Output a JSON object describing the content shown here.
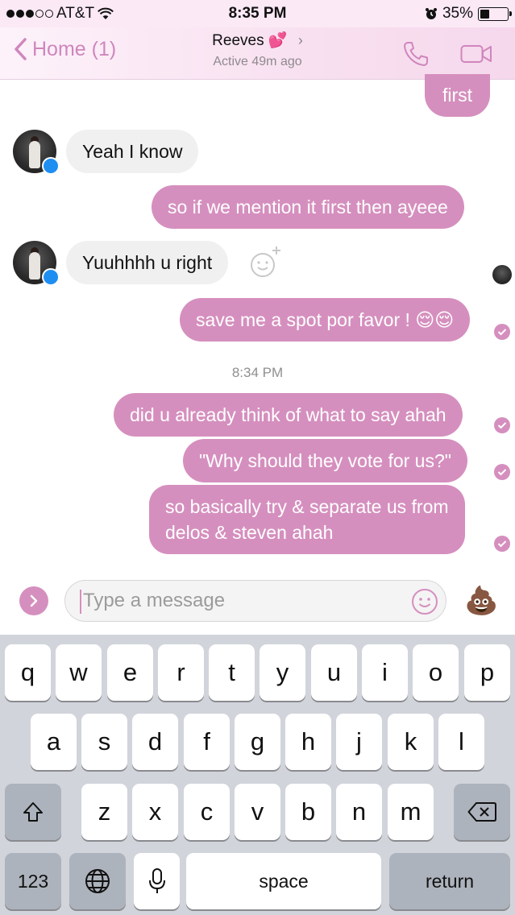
{
  "status_bar": {
    "carrier": "AT&T",
    "time": "8:35 PM",
    "battery": "35%",
    "battery_level": 0.35
  },
  "header": {
    "back_label": "Home (1)",
    "contact_name": "Reeves",
    "contact_emoji": "💕",
    "status": "Active 49m ago",
    "call_icon": "phone-icon",
    "video_icon": "video-camera-icon"
  },
  "messages": [
    {
      "direction": "out",
      "text": "first"
    },
    {
      "direction": "in",
      "text": "Yeah I know"
    },
    {
      "direction": "out",
      "text": "so if we mention it first then ayeee"
    },
    {
      "direction": "in",
      "text": "Yuuhhhh u right"
    },
    {
      "direction": "out",
      "text": "save me a spot por favor ! 😌😌"
    },
    {
      "timestamp": "8:34 PM"
    },
    {
      "direction": "out",
      "text": "did u already think of what to say ahah"
    },
    {
      "direction": "out",
      "text": "\"Why should they vote for us?\""
    },
    {
      "direction": "out",
      "text_line1": "so basically try & separate us from",
      "text_line2": "delos & steven ahah"
    }
  ],
  "composer": {
    "placeholder": "Type a message",
    "emoji_icon": "smiley-icon",
    "quick_reaction": "💩"
  },
  "keyboard": {
    "row1": [
      "q",
      "w",
      "e",
      "r",
      "t",
      "y",
      "u",
      "i",
      "o",
      "p"
    ],
    "row2": [
      "a",
      "s",
      "d",
      "f",
      "g",
      "h",
      "j",
      "k",
      "l"
    ],
    "row3": [
      "z",
      "x",
      "c",
      "v",
      "b",
      "n",
      "m"
    ],
    "numbers_label": "123",
    "space_label": "space",
    "return_label": "return"
  },
  "colors": {
    "accent": "#d58fbe",
    "incoming_bubble": "#f0f0f0",
    "keyboard_bg": "#d1d4db"
  }
}
